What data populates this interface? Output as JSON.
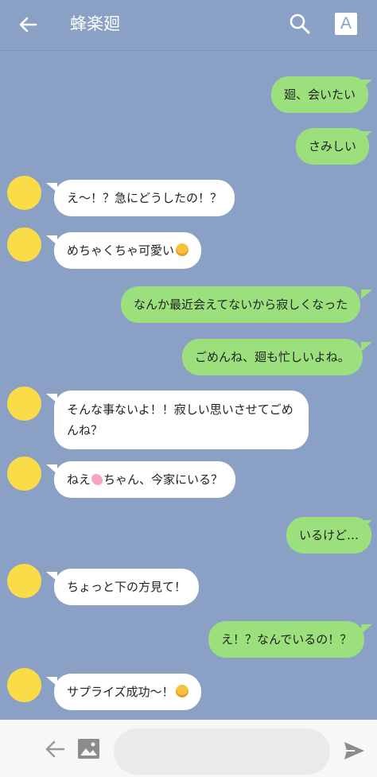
{
  "header": {
    "back_icon": "arrow-left-icon",
    "title": "蜂楽廻",
    "search_icon": "search-icon",
    "font_icon": "font-size-icon",
    "font_label": "A"
  },
  "messages": [
    {
      "side": "out",
      "text": "廻、会いたい"
    },
    {
      "side": "out",
      "text": "さみしい"
    },
    {
      "side": "in",
      "text": "え〜！？急にどうしたの！？"
    },
    {
      "side": "in",
      "text": "めちゃくちゃ可愛い",
      "emoji": "smiling-face"
    },
    {
      "side": "out",
      "text": "なんか最近会えてないから寂しくなった"
    },
    {
      "side": "out",
      "text": "ごめんね、廻も忙しいよね。"
    },
    {
      "side": "in",
      "text": "そんな事ないよ！！寂しい思いさせてごめんね？"
    },
    {
      "side": "in",
      "text_a": "ねえ",
      "emoji": "cherry-blossom",
      "text_b": "ちゃん、今家にいる？"
    },
    {
      "side": "out",
      "text": "いるけど…"
    },
    {
      "side": "in",
      "text": "ちょっと下の方見て！"
    },
    {
      "side": "out",
      "text": "え！？なんでいるの！？"
    },
    {
      "side": "in",
      "text": "サプライズ成功〜！",
      "emoji": "winking-face"
    }
  ],
  "footer": {
    "back_icon": "arrow-left-icon",
    "image_icon": "image-icon",
    "input_value": "",
    "input_placeholder": "",
    "send_icon": "send-icon"
  },
  "colors": {
    "background": "#8aa0c4",
    "outgoing_bubble": "#9be07d",
    "incoming_bubble": "#ffffff",
    "avatar": "#fadb48"
  }
}
